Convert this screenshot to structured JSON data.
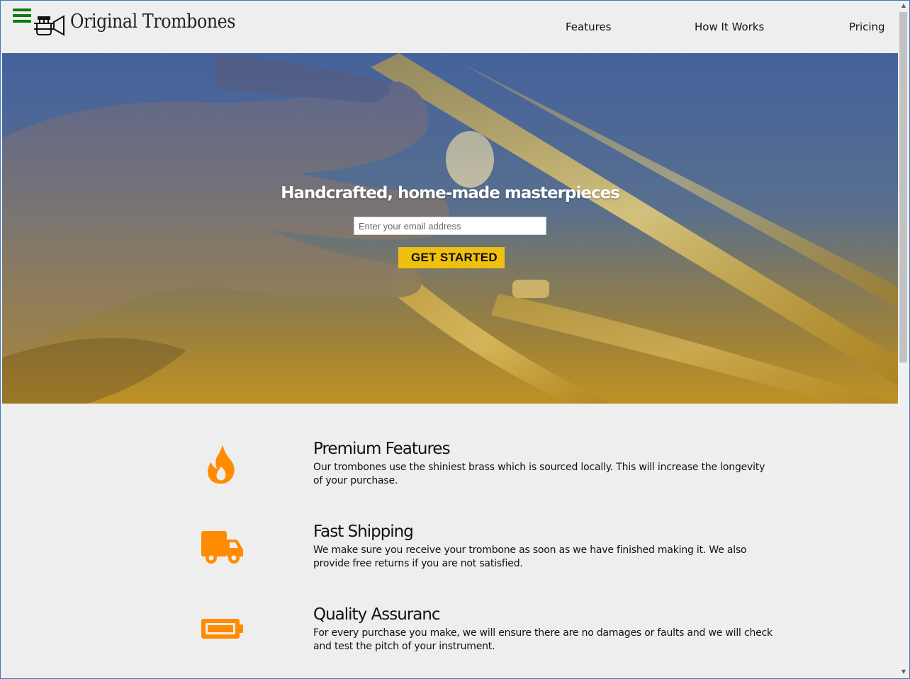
{
  "header": {
    "menu_icon": "hamburger-menu-icon",
    "logo_icon": "trumpet-icon",
    "logo_text": "Original Trombones",
    "nav": [
      {
        "label": "Features"
      },
      {
        "label": "How It Works"
      },
      {
        "label": "Pricing"
      }
    ],
    "menu_color": "#0f7a0f"
  },
  "hero": {
    "title": "Handcrafted, home-made masterpieces",
    "email_placeholder": "Enter your email address",
    "email_value": "",
    "cta_label": "GET STARTED",
    "cta_color": "#f0c010"
  },
  "features": [
    {
      "icon": "fire-icon",
      "title": "Premium Features",
      "description": "Our trombones use the shiniest brass which is sourced locally. This will increase the longevity of your purchase."
    },
    {
      "icon": "truck-icon",
      "title": "Fast Shipping",
      "description": "We make sure you receive your trombone as soon as we have finished making it. We also provide free returns if you are not satisfied."
    },
    {
      "icon": "battery-icon",
      "title": "Quality Assuranc",
      "description": "For every purchase you make, we will ensure there are no damages or faults and we will check and test the pitch of your instrument."
    }
  ],
  "accent_color": "#ff8c00"
}
